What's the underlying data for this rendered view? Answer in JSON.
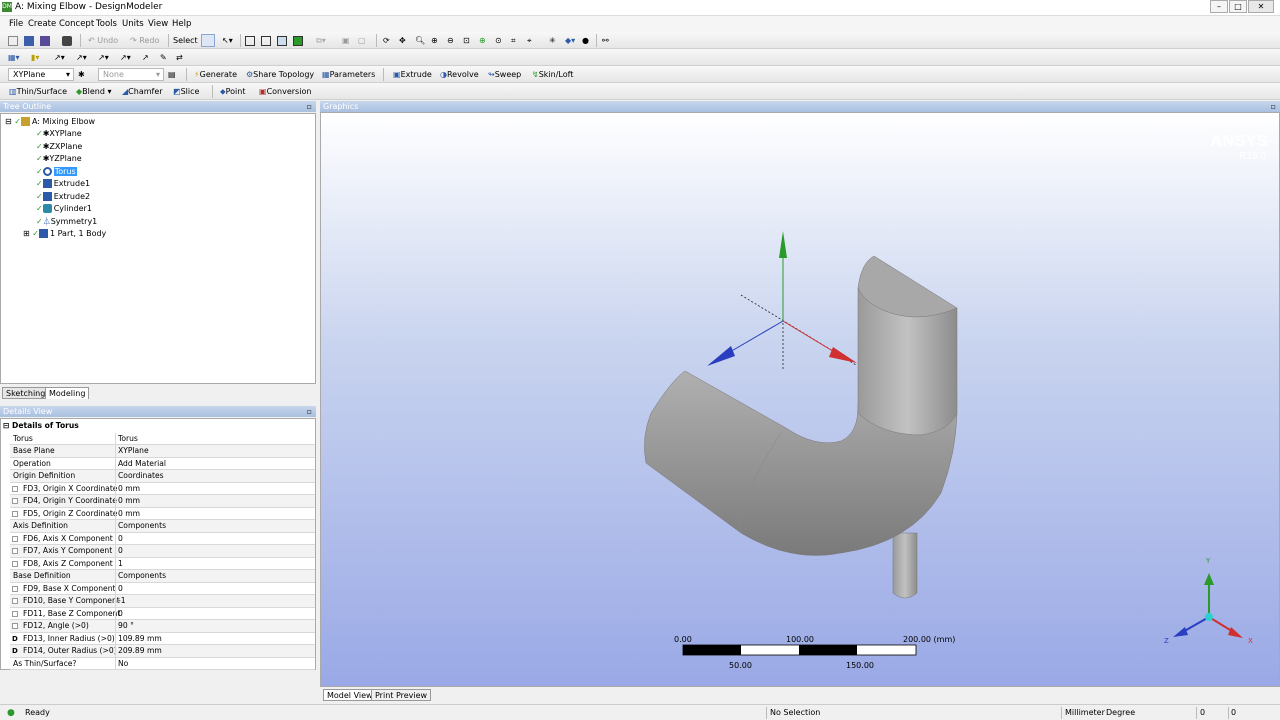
{
  "window": {
    "title": "A: Mixing Elbow - DesignModeler",
    "app_icon": "DM"
  },
  "menu": [
    "File",
    "Create",
    "Concept",
    "Tools",
    "Units",
    "View",
    "Help"
  ],
  "toolbar1": {
    "undo": "Undo",
    "redo": "Redo",
    "select": "Select"
  },
  "toolbar2": {},
  "toolbar3": {
    "plane": "XYPlane",
    "sketch": "None",
    "generate": "Generate",
    "share_topology": "Share Topology",
    "parameters": "Parameters",
    "extrude": "Extrude",
    "revolve": "Revolve",
    "sweep": "Sweep",
    "skin_loft": "Skin/Loft"
  },
  "toolbar4": {
    "thin_surface": "Thin/Surface",
    "blend": "Blend",
    "chamfer": "Chamfer",
    "slice": "Slice",
    "point": "Point",
    "conversion": "Conversion"
  },
  "tree": {
    "header": "Tree Outline",
    "root": "A: Mixing Elbow",
    "items": [
      "XYPlane",
      "ZXPlane",
      "YZPlane",
      "Torus",
      "Extrude1",
      "Extrude2",
      "Cylinder1",
      "Symmetry1"
    ],
    "parts": "1 Part, 1 Body",
    "selected": "Torus"
  },
  "tabs": {
    "sketching": "Sketching",
    "modeling": "Modeling"
  },
  "details": {
    "header": "Details View",
    "title": "Details of Torus",
    "rows": [
      {
        "k": "Torus",
        "v": "Torus"
      },
      {
        "k": "Base Plane",
        "v": "XYPlane"
      },
      {
        "k": "Operation",
        "v": "Add Material"
      },
      {
        "k": "Origin Definition",
        "v": "Coordinates"
      },
      {
        "k": "FD3, Origin X Coordinate",
        "v": "0 mm"
      },
      {
        "k": "FD4, Origin Y Coordinate",
        "v": "0 mm"
      },
      {
        "k": "FD5, Origin Z Coordinate",
        "v": "0 mm"
      },
      {
        "k": "Axis Definition",
        "v": "Components"
      },
      {
        "k": "FD6, Axis X Component",
        "v": "0"
      },
      {
        "k": "FD7, Axis Y Component",
        "v": "0"
      },
      {
        "k": "FD8, Axis Z Component",
        "v": "1"
      },
      {
        "k": "Base Definition",
        "v": "Components"
      },
      {
        "k": "FD9, Base X Component",
        "v": "0"
      },
      {
        "k": "FD10, Base Y Component",
        "v": "-1"
      },
      {
        "k": "FD11, Base Z Component",
        "v": "0"
      },
      {
        "k": "FD12, Angle (>0)",
        "v": "90 °"
      },
      {
        "k": "FD13, Inner Radius (>0)",
        "v": "109.89 mm"
      },
      {
        "k": "FD14, Outer Radius (>0)",
        "v": "209.89 mm"
      },
      {
        "k": "As Thin/Surface?",
        "v": "No"
      }
    ]
  },
  "graphics": {
    "header": "Graphics",
    "brand": "ANSYS",
    "version": "R15.0",
    "scale": {
      "t0": "0.00",
      "t100": "100.00",
      "t200": "200.00 (mm)",
      "t50": "50.00",
      "t150": "150.00"
    },
    "axes": {
      "y": "Y",
      "x": "X",
      "z": "Z"
    },
    "tab_model": "Model View",
    "tab_print": "Print Preview"
  },
  "status": {
    "ready": "Ready",
    "selection": "No Selection",
    "units": "Millimeter",
    "angle": "Degree",
    "v1": "0",
    "v2": "0"
  },
  "colors": {
    "selection": "#3399ff",
    "axis_x": "#d03030",
    "axis_y": "#2a9a2a",
    "axis_z": "#2a3ec0"
  }
}
